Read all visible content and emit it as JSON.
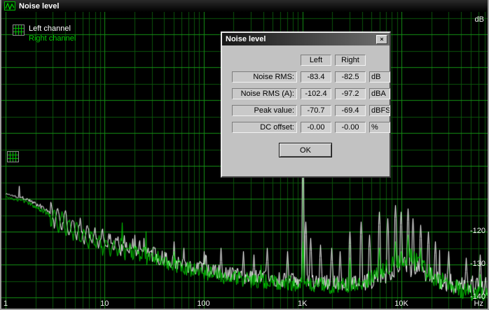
{
  "window": {
    "title": "Noise level"
  },
  "legend": {
    "items": [
      {
        "label": "Left channel",
        "color": "#ffffff"
      },
      {
        "label": "Right channel",
        "color": "#00cc00"
      }
    ]
  },
  "axis": {
    "x_tick_labels": [
      "1",
      "10",
      "100",
      "1K",
      "10K"
    ],
    "x_tick_values": [
      1,
      10,
      100,
      1000,
      10000
    ],
    "x_unit": "Hz",
    "y_unit": "dB",
    "y_tick_labels": [
      "-120",
      "-130",
      "-140"
    ],
    "y_tick_values": [
      -120,
      -130,
      -140
    ]
  },
  "dialog": {
    "title": "Noise level",
    "close_label": "×",
    "columns": [
      "Left",
      "Right"
    ],
    "rows": [
      {
        "label": "Noise RMS:",
        "left": "-83.4",
        "right": "-82.5",
        "unit": "dB"
      },
      {
        "label": "Noise RMS (A):",
        "left": "-102.4",
        "right": "-97.2",
        "unit": "dBA"
      },
      {
        "label": "Peak value:",
        "left": "-70.7",
        "right": "-69.4",
        "unit": "dBFS"
      },
      {
        "label": "DC offset:",
        "left": "-0.00",
        "right": "-0.00",
        "unit": "%"
      }
    ],
    "ok_label": "OK"
  },
  "colors": {
    "plot_bg": "#000000",
    "grid_major": "#149114",
    "grid_minor": "#0b550b",
    "trace_left": "#ffffff",
    "trace_right": "#00cc00",
    "dialog_bg": "#c2c2c2"
  },
  "chart_data": {
    "type": "line",
    "title": "Noise level",
    "x_axis": {
      "scale": "log",
      "min_hz": 1,
      "max_hz": 74000,
      "unit": "Hz"
    },
    "y_axis": {
      "unit": "dB",
      "grid_step_db": 5,
      "labeled_db": [
        -120,
        -130,
        -140
      ]
    },
    "series": [
      {
        "name": "Left channel",
        "color": "#ffffff",
        "seed": 1337,
        "minispike_prob": 0.012,
        "anchors": [
          [
            1,
            -108.5
          ],
          [
            1.6,
            -110
          ],
          [
            2.5,
            -113
          ],
          [
            4,
            -117
          ],
          [
            6,
            -120.5
          ],
          [
            10,
            -123
          ],
          [
            18,
            -124.5
          ],
          [
            30,
            -127
          ],
          [
            60,
            -130
          ],
          [
            120,
            -132
          ],
          [
            250,
            -133.5
          ],
          [
            500,
            -134.5
          ],
          [
            1000,
            -135
          ],
          [
            2000,
            -135.5
          ],
          [
            4000,
            -135.5
          ],
          [
            6000,
            -134
          ],
          [
            8000,
            -132
          ],
          [
            11000,
            -130.5
          ],
          [
            14000,
            -131.5
          ],
          [
            18000,
            -133.5
          ],
          [
            28000,
            -135.5
          ],
          [
            45000,
            -136.5
          ],
          [
            74000,
            -137
          ]
        ],
        "spikes": [
          [
            20,
            -121
          ],
          [
            25,
            -122
          ],
          [
            50,
            -123
          ],
          [
            63,
            -125
          ],
          [
            100,
            -126
          ],
          [
            150,
            -125
          ],
          [
            250,
            -126
          ],
          [
            320,
            -127
          ],
          [
            440,
            -125
          ],
          [
            700,
            -126
          ],
          [
            1000,
            -100
          ],
          [
            1080,
            -117
          ],
          [
            1200,
            -122
          ],
          [
            1500,
            -124
          ],
          [
            1950,
            -125
          ],
          [
            2400,
            -126
          ],
          [
            3000,
            -120
          ],
          [
            3900,
            -117
          ],
          [
            4700,
            -121
          ],
          [
            5900,
            -114
          ],
          [
            7200,
            -116
          ],
          [
            8600,
            -112
          ],
          [
            9800,
            -114
          ],
          [
            11500,
            -113
          ],
          [
            13000,
            -116
          ],
          [
            15500,
            -118
          ],
          [
            18500,
            -120
          ],
          [
            22000,
            -123
          ],
          [
            30000,
            -126
          ],
          [
            45000,
            -128
          ],
          [
            62000,
            -127
          ]
        ]
      },
      {
        "name": "Right channel",
        "color": "#00cc00",
        "seed": 4242,
        "minispike_prob": 0.006,
        "anchors": [
          [
            1,
            -109.5
          ],
          [
            1.6,
            -111
          ],
          [
            2.5,
            -114
          ],
          [
            4,
            -118
          ],
          [
            6,
            -121.5
          ],
          [
            10,
            -124
          ],
          [
            18,
            -125.5
          ],
          [
            30,
            -128
          ],
          [
            60,
            -131
          ],
          [
            120,
            -133
          ],
          [
            250,
            -134.5
          ],
          [
            500,
            -135.5
          ],
          [
            1000,
            -136
          ],
          [
            2000,
            -136.5
          ],
          [
            4000,
            -136
          ],
          [
            6000,
            -132.5
          ],
          [
            8000,
            -129.5
          ],
          [
            11000,
            -127.5
          ],
          [
            14000,
            -129
          ],
          [
            18000,
            -132
          ],
          [
            28000,
            -136
          ],
          [
            45000,
            -138
          ],
          [
            74000,
            -139.5
          ]
        ],
        "spikes": [
          [
            50,
            -126
          ],
          [
            1000,
            -123
          ],
          [
            3000,
            -128
          ],
          [
            5900,
            -125
          ],
          [
            8600,
            -123
          ],
          [
            11500,
            -121
          ],
          [
            15500,
            -125
          ],
          [
            62000,
            -133
          ]
        ]
      }
    ],
    "jitter_amp": [
      [
        1,
        0.3
      ],
      [
        2.5,
        0.8
      ],
      [
        6,
        1.2
      ],
      [
        15,
        1.6
      ],
      [
        40,
        2.2
      ],
      [
        100,
        2.4
      ],
      [
        300,
        2.4
      ],
      [
        1000,
        2.4
      ],
      [
        3000,
        2.6
      ],
      [
        8000,
        2.8
      ],
      [
        20000,
        3.2
      ],
      [
        74000,
        2.6
      ]
    ],
    "zigzag": {
      "f_min": 2.8,
      "f_max": 38,
      "amp_start_db": 3.8,
      "amp_end_db": 1.0,
      "period_decades": 0.075,
      "phase": [
        0,
        0.45
      ]
    }
  }
}
